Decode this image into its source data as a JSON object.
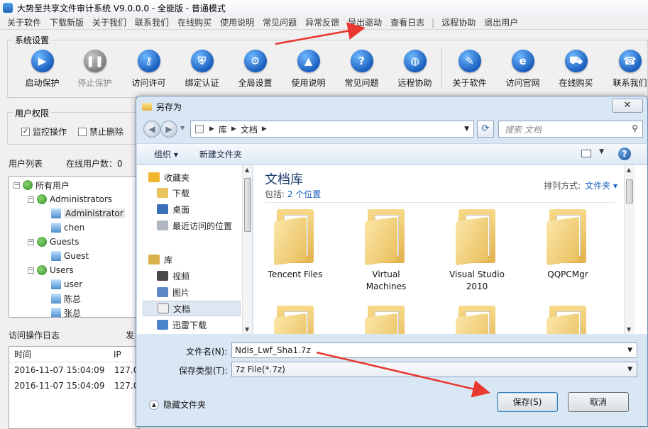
{
  "main": {
    "title": "大势至共享文件审计系统 V9.0.0.0 - 全能版 - 普通模式",
    "menu": [
      "关于软件",
      "下载新版",
      "关于我们",
      "联系我们",
      "在线购买",
      "使用说明",
      "常见问题",
      "异常反馈",
      "导出驱动",
      "查看日志",
      "|",
      "远程协助",
      "退出用户"
    ],
    "settings_group_label": "系统设置",
    "toolbar": [
      {
        "label": "启动保护",
        "icon": "play-icon",
        "enabled": true
      },
      {
        "label": "停止保护",
        "icon": "pause-icon",
        "enabled": false
      },
      {
        "label": "访问许可",
        "icon": "key-icon",
        "enabled": true
      },
      {
        "label": "绑定认证",
        "icon": "shield-icon",
        "enabled": true
      },
      {
        "label": "全局设置",
        "icon": "gear-icon",
        "enabled": true
      },
      {
        "label": "使用说明",
        "icon": "graduation-cap-icon",
        "enabled": true
      },
      {
        "label": "常见问题",
        "icon": "question-icon",
        "enabled": true
      },
      {
        "label": "远程协助",
        "icon": "globe-icon",
        "enabled": true
      },
      {
        "label": "关于软件",
        "icon": "notepad-icon",
        "enabled": true
      },
      {
        "label": "访问官网",
        "icon": "ie-icon",
        "enabled": true
      },
      {
        "label": "在线购买",
        "icon": "cart-icon",
        "enabled": true
      },
      {
        "label": "联系我们",
        "icon": "phone-icon",
        "enabled": true
      }
    ],
    "permissions_label": "用户权限",
    "permission_checks": [
      {
        "label": "监控操作",
        "checked": true
      },
      {
        "label": "禁止删除",
        "checked": false
      }
    ],
    "user_list_label": "用户列表",
    "online_count_label": "在线用户数：0",
    "user_tree": [
      {
        "label": "所有用户",
        "level": 0,
        "type": "root"
      },
      {
        "label": "Administrators",
        "level": 1,
        "type": "group"
      },
      {
        "label": "Administrator",
        "level": 2,
        "type": "user",
        "selected": true
      },
      {
        "label": "chen",
        "level": 2,
        "type": "user"
      },
      {
        "label": "Guests",
        "level": 1,
        "type": "group"
      },
      {
        "label": "Guest",
        "level": 2,
        "type": "user"
      },
      {
        "label": "Users",
        "level": 1,
        "type": "group"
      },
      {
        "label": "user",
        "level": 2,
        "type": "user"
      },
      {
        "label": "陈总",
        "level": 2,
        "type": "user"
      },
      {
        "label": "张总",
        "level": 2,
        "type": "user"
      }
    ],
    "log_label": "访问操作日志",
    "log_label_cut": "发",
    "log_columns": [
      "时间",
      "IP"
    ],
    "log_rows": [
      [
        "2016-11-07 15:04:09",
        "127.0"
      ],
      [
        "2016-11-07 15:04:09",
        "127.0"
      ]
    ]
  },
  "dialog": {
    "title": "另存为",
    "close_symbol": "✕",
    "breadcrumbs": [
      "库",
      "文档"
    ],
    "search_placeholder": "搜索 文档",
    "commands": [
      "组织 ▾",
      "新建文件夹"
    ],
    "nav_items": [
      {
        "label": "收藏夹",
        "icon": "star-icon",
        "indent": 0
      },
      {
        "label": "下载",
        "icon": "download-folder-icon",
        "indent": 1
      },
      {
        "label": "桌面",
        "icon": "desktop-icon",
        "indent": 1
      },
      {
        "label": "最近访问的位置",
        "icon": "recent-places-icon",
        "indent": 1
      },
      {
        "label": "库",
        "icon": "library-icon",
        "indent": 0
      },
      {
        "label": "视频",
        "icon": "video-icon",
        "indent": 1
      },
      {
        "label": "图片",
        "icon": "picture-icon",
        "indent": 1
      },
      {
        "label": "文档",
        "icon": "document-icon",
        "indent": 1,
        "selected": true
      },
      {
        "label": "迅雷下载",
        "icon": "thunder-icon",
        "indent": 1
      }
    ],
    "library_title": "文档库",
    "library_sub_prefix": "包括: ",
    "library_sub_link": "2 个位置",
    "arrange_label": "排列方式:",
    "arrange_value": "文件夹 ▾",
    "folders": [
      "Tencent Files",
      "Virtual\nMachines",
      "Visual Studio\n2010",
      "QQPCMgr"
    ],
    "filename_label": "文件名(N):",
    "filename_value": "Ndis_Lwf_Sha1.7z",
    "filetype_label": "保存类型(T):",
    "filetype_value": "7z File(*.7z)",
    "hide_folders_label": "隐藏文件夹",
    "save_label": "保存(S)",
    "cancel_label": "取消"
  },
  "colors": {
    "annotation_arrow": "#e8382f",
    "accent_blue": "#1a5fbe"
  }
}
